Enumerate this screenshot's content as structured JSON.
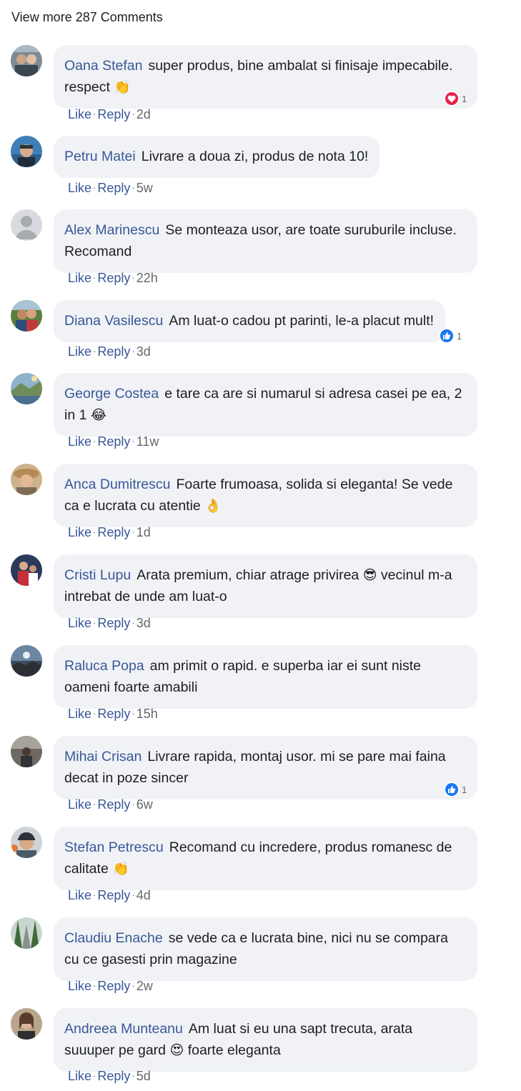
{
  "header": {
    "view_more": "View more 287 Comments"
  },
  "actions": {
    "like": "Like",
    "reply": "Reply",
    "sep": "·"
  },
  "colors": {
    "link": "#385898",
    "bubble": "#f0f2f5",
    "like_blue": "#1877f2",
    "love_red": "#e4234a"
  },
  "comments": [
    {
      "name": "Oana Stefan",
      "text": "super produs, bine ambalat si finisaje impecabile. respect",
      "emoji": "👏",
      "time": "2d",
      "reaction": {
        "type": "love",
        "count": "1"
      }
    },
    {
      "name": "Petru Matei",
      "text": "Livrare a doua zi, produs de nota 10!",
      "time": "5w"
    },
    {
      "name": "Alex Marinescu",
      "text": "Se monteaza usor, are toate suruburile incluse. Recomand",
      "time": "22h"
    },
    {
      "name": "Diana Vasilescu",
      "text": "Am luat-o cadou pt parinti, le-a placut mult!",
      "time": "3d",
      "reaction": {
        "type": "like",
        "count": "1"
      }
    },
    {
      "name": "George Costea",
      "text": "e tare ca are si numarul si adresa casei pe ea, 2 in 1",
      "emoji": "😂",
      "time": "11w"
    },
    {
      "name": "Anca Dumitrescu",
      "text": "Foarte frumoasa, solida si eleganta! Se vede ca e lucrata cu atentie",
      "emoji": "👌",
      "time": "1d"
    },
    {
      "name": "Cristi Lupu",
      "text": "Arata premium, chiar atrage privirea",
      "emoji": "😎",
      "text2": "vecinul m-a intrebat de unde am luat-o",
      "time": "3d"
    },
    {
      "name": "Raluca Popa",
      "text": "am primit o rapid. e superba iar ei sunt niste oameni foarte amabili",
      "time": "15h"
    },
    {
      "name": "Mihai Crisan",
      "text": "Livrare rapida, montaj usor. mi se pare mai faina decat in poze sincer",
      "time": "6w",
      "reaction": {
        "type": "like",
        "count": "1"
      }
    },
    {
      "name": "Stefan Petrescu",
      "text": "Recomand cu incredere, produs romanesc de calitate",
      "emoji": "👏",
      "time": "4d"
    },
    {
      "name": "Claudiu Enache",
      "text": "se vede ca e lucrata bine, nici nu se compara cu ce gasesti prin magazine",
      "time": "2w"
    },
    {
      "name": "Andreea Munteanu",
      "text": "Am luat si eu una sapt trecuta, arata suuuper pe gard",
      "emoji": "😍",
      "text2": "foarte eleganta",
      "time": "5d"
    }
  ]
}
